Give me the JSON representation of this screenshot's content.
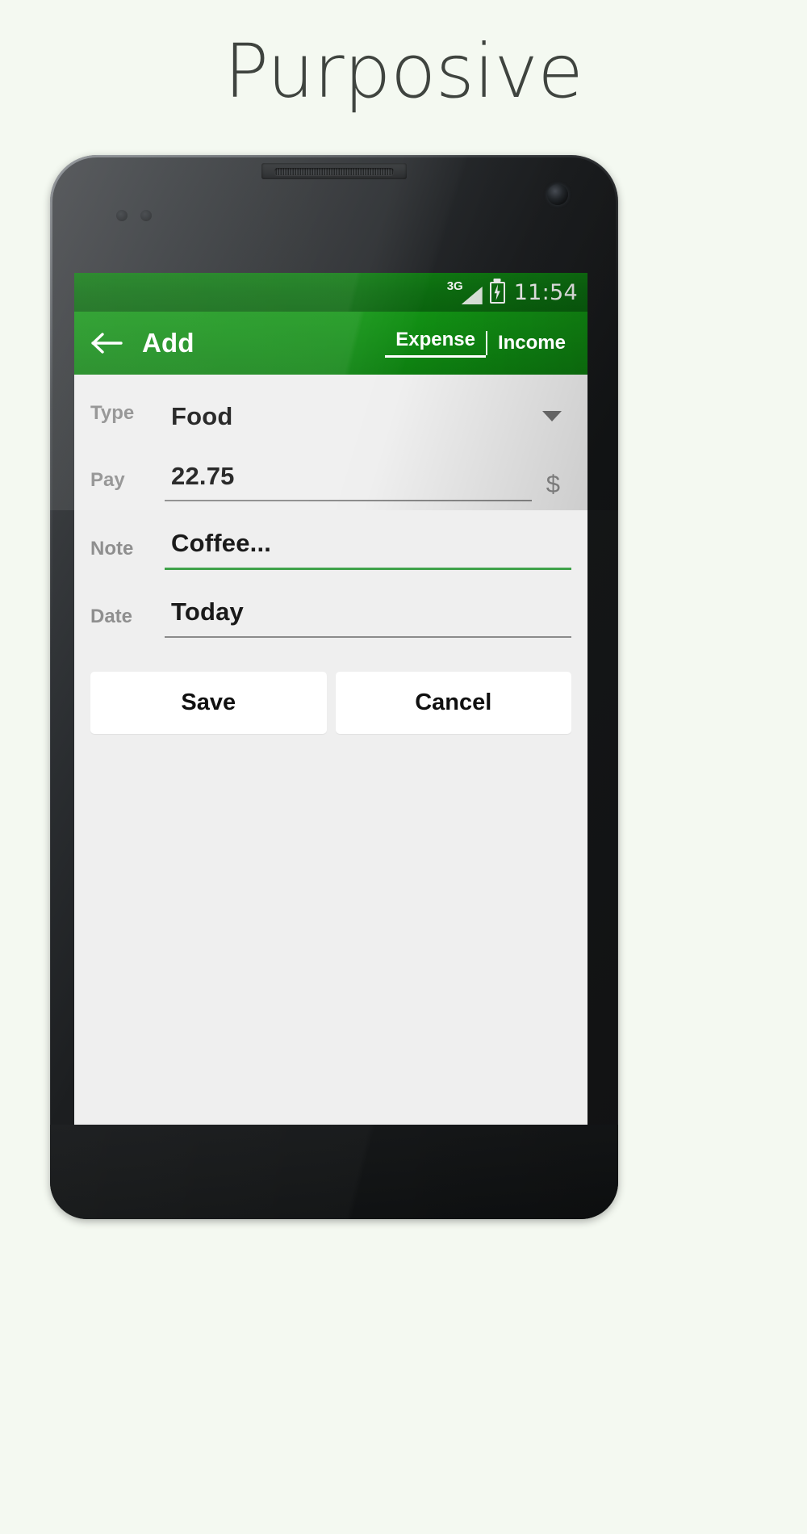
{
  "page": {
    "title": "Purposive",
    "background_color": "#f4f9f1",
    "title_color": "#3f443f"
  },
  "device": {
    "name": "android-phone-mockup",
    "body_color": "#141617"
  },
  "status_bar": {
    "network_label": "3G",
    "signal_icon": "signal-bars-icon",
    "battery_icon": "battery-charging-icon",
    "time": "11:54",
    "background_color": "#0c6e10"
  },
  "action_bar": {
    "back_icon": "arrow-left-icon",
    "title": "Add",
    "background_color": "#0f8a12",
    "tabs": [
      {
        "label": "Expense",
        "active": true
      },
      {
        "label": "Income",
        "active": false
      }
    ]
  },
  "form": {
    "background_color": "#efefef",
    "accent_color": "#3fa24a",
    "fields": [
      {
        "label": "Type",
        "value": "Food",
        "control": "dropdown",
        "icon": "chevron-down-icon",
        "underline": "none",
        "focused": false
      },
      {
        "label": "Pay",
        "value": "22.75",
        "control": "text-input",
        "suffix": "$",
        "underline": "gray",
        "focused": false
      },
      {
        "label": "Note",
        "value": "Coffee...",
        "control": "text-input",
        "underline": "green",
        "focused": true
      },
      {
        "label": "Date",
        "value": "Today",
        "control": "date-input",
        "underline": "gray",
        "focused": false
      }
    ],
    "buttons": [
      {
        "label": "Save"
      },
      {
        "label": "Cancel"
      }
    ]
  },
  "nav_bar": {
    "background_color": "#000000",
    "buttons": [
      {
        "name": "back",
        "icon": "triangle-back-icon"
      },
      {
        "name": "home",
        "icon": "circle-home-icon"
      },
      {
        "name": "recents",
        "icon": "square-recents-icon"
      }
    ]
  }
}
